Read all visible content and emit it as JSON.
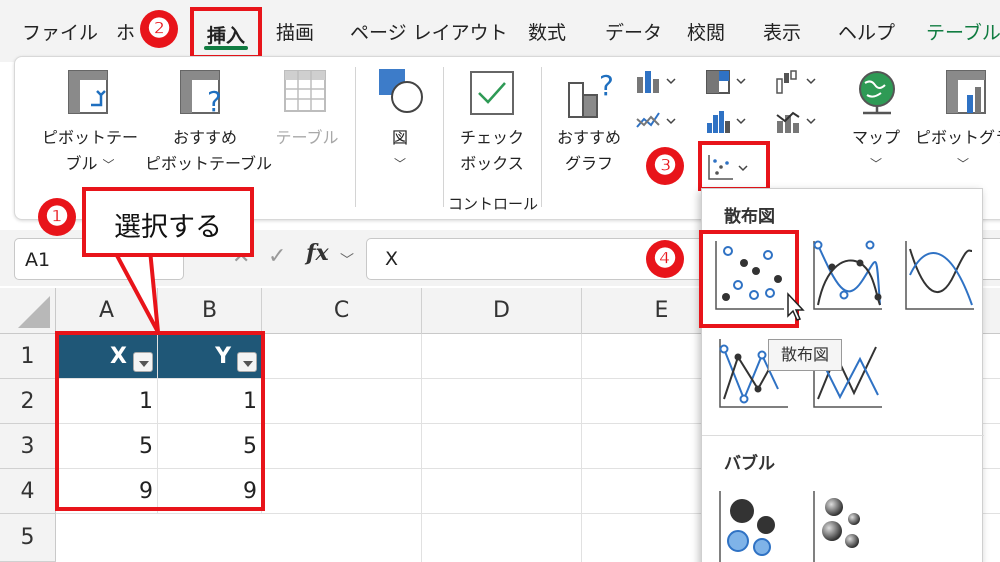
{
  "tabs": {
    "file": "ファイル",
    "home_partial": "ホ",
    "insert": "挿入",
    "draw": "描画",
    "page_layout": "ページ レイアウト",
    "formulas": "数式",
    "data": "データ",
    "review": "校閲",
    "view": "表示",
    "help": "ヘルプ",
    "table": "テーブル"
  },
  "ribbon": {
    "pivot_table_l1": "ピボットテー",
    "pivot_table_l2": "ブル",
    "recommended_pivot_l1": "おすすめ",
    "recommended_pivot_l2": "ピボットテーブル",
    "table": "テーブル",
    "illustrations": "図",
    "checkbox_l1": "チェック",
    "checkbox_l2": "ボックス",
    "controls_group": "コントロール",
    "recommended_chart_l1": "おすすめ",
    "recommended_chart_l2": "グラフ",
    "map": "マップ",
    "pivot_chart_partial": "ピボットグラ"
  },
  "formula_bar": {
    "name_box": "A1",
    "fx": "fx",
    "value": "X"
  },
  "columns": [
    "A",
    "B",
    "C",
    "D",
    "E"
  ],
  "rows": [
    "1",
    "2",
    "3",
    "4",
    "5"
  ],
  "table": {
    "headers": [
      "X",
      "Y"
    ],
    "rows": [
      [
        "1",
        "1"
      ],
      [
        "5",
        "5"
      ],
      [
        "9",
        "9"
      ]
    ]
  },
  "annotations": {
    "step1": "❶",
    "step2": "❷",
    "step3": "❸",
    "step4": "❹",
    "callout": "選択する"
  },
  "dropdown": {
    "scatter_title": "散布図",
    "bubble_title": "バブル",
    "tooltip": "散布図"
  },
  "colors": {
    "accent_red": "#e8141a",
    "excel_green": "#107c41",
    "table_header": "#1f5777"
  }
}
